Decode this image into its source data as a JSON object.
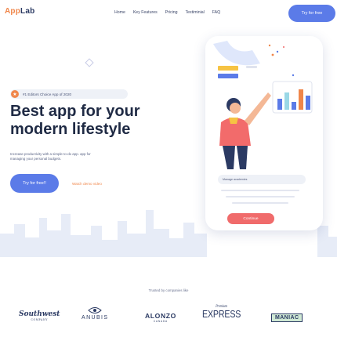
{
  "header": {
    "logo_prefix": "App",
    "logo_suffix": "Lab",
    "nav": [
      "Home",
      "Key Features",
      "Pricing",
      "Testiminial",
      "FAQ"
    ],
    "cta_label": "Try for free"
  },
  "hero": {
    "badge": "#1 Editors Choice App of 2020",
    "headline_line1": "Best app for your",
    "headline_line2": "modern lifestyle",
    "subtext_line1": "Increase productivity with a simple to-do app. app for",
    "subtext_line2": "managing your personal budgets.",
    "primary_button": "Try for free!!",
    "video_link": "Watch demo video"
  },
  "phone": {
    "manage_label": "Manage academies",
    "continue_label": "Continue"
  },
  "trusted": {
    "label": "Trusted by companies like",
    "brands": {
      "southwest": "Southwest",
      "southwest_sub": "COMPANY",
      "anubis": "ANUBIS",
      "anubis_sub": "",
      "alonzo": "ALONZO",
      "alonzo_sub": "CANADA",
      "express": "EXPRESS",
      "express_sub": "Premium",
      "maniac": "MANIAC"
    }
  },
  "colors": {
    "accent_blue": "#5b7be8",
    "accent_orange": "#f0864a",
    "accent_red": "#f06b6b",
    "heading": "#1f2a44"
  }
}
